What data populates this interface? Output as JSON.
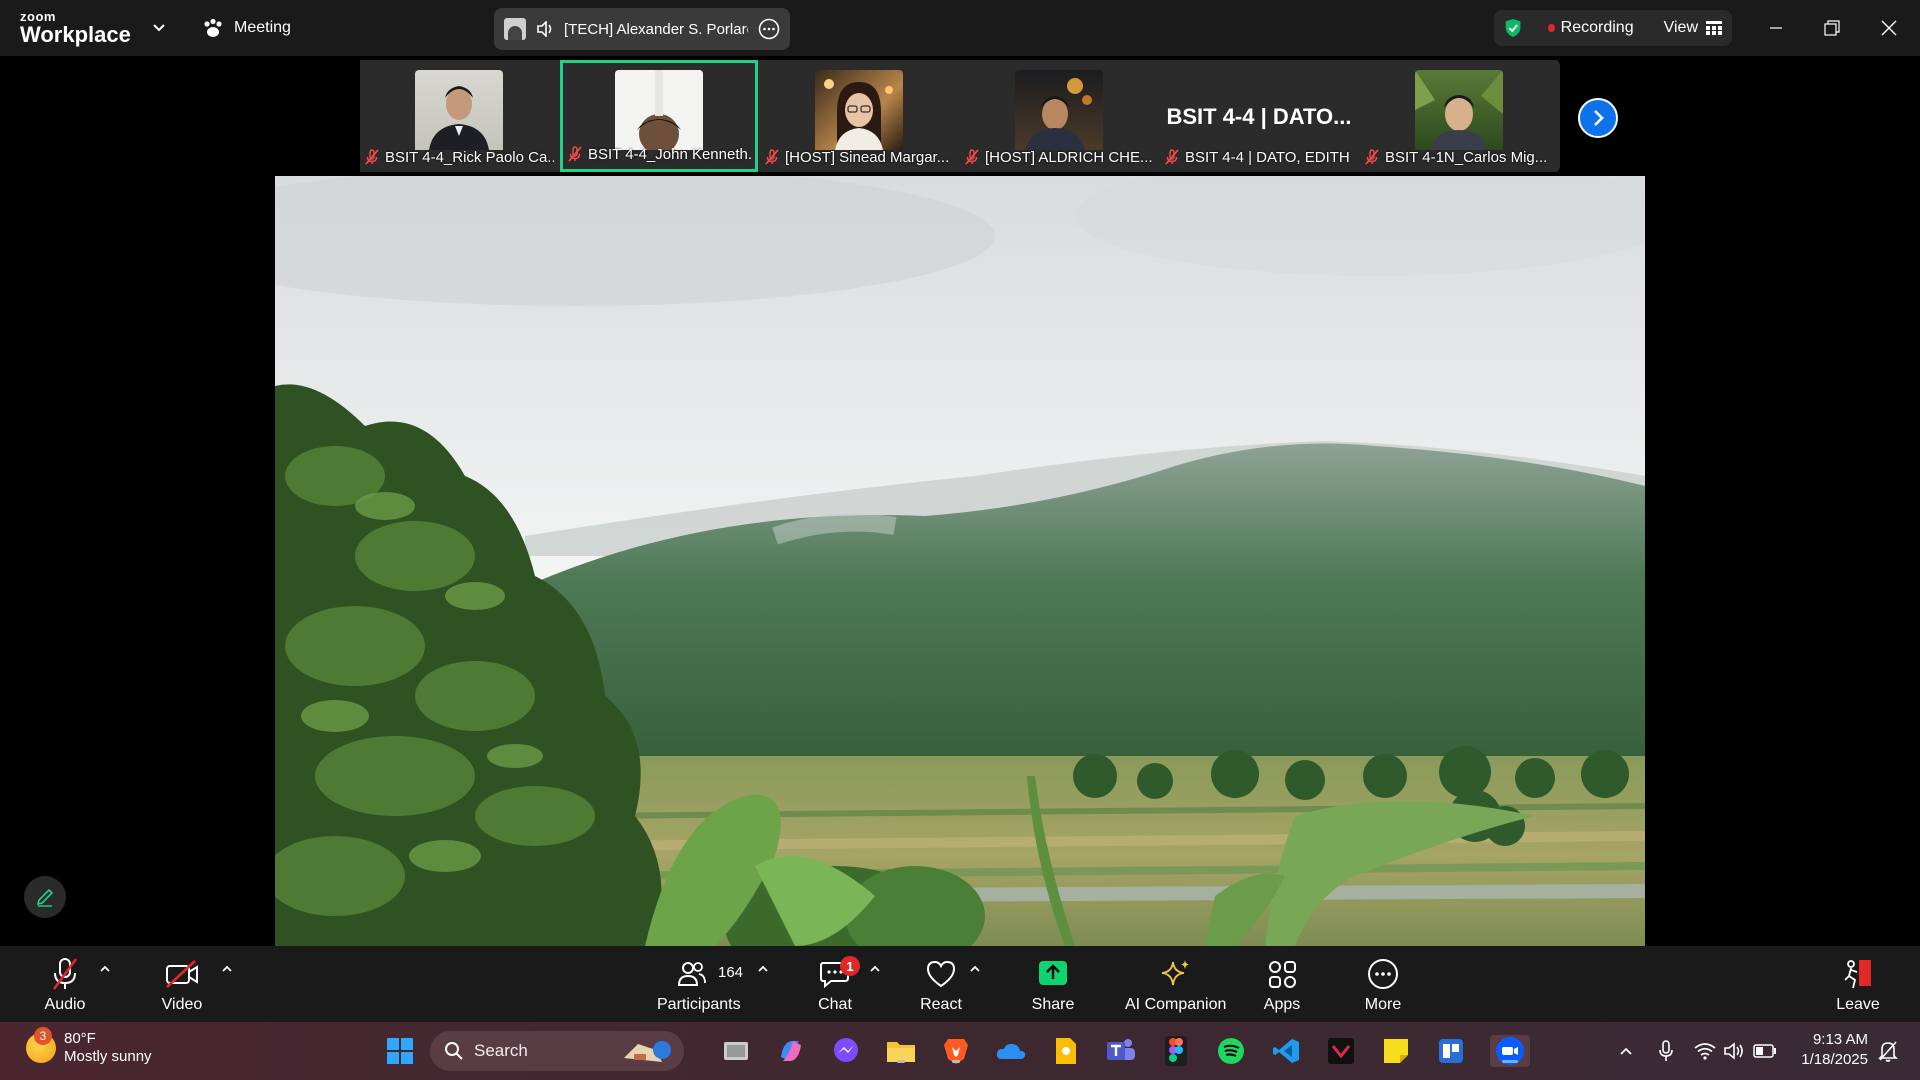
{
  "app": {
    "brand_small": "zoom",
    "brand_big": "Workplace",
    "meeting_label": "Meeting",
    "active_speaker": "[TECH] Alexander S. Porlares",
    "recording_label": "Recording",
    "view_label": "View"
  },
  "gallery": {
    "tiles": [
      {
        "name": "BSIT 4-4_Rick Paolo Ca...",
        "kind": "video"
      },
      {
        "name": "BSIT 4-4_John Kenneth...",
        "kind": "video",
        "active": true
      },
      {
        "name": "[HOST] Sinead Margar...",
        "kind": "video"
      },
      {
        "name": "[HOST] ALDRICH CHE...",
        "kind": "video"
      },
      {
        "name": "BSIT 4-4 | DATO, EDITH",
        "kind": "name",
        "display_name": "BSIT 4-4 | DATO..."
      },
      {
        "name": "BSIT 4-1N_Carlos Mig...",
        "kind": "video"
      }
    ]
  },
  "controls": {
    "audio": "Audio",
    "video": "Video",
    "participants": "Participants",
    "participants_count": "164",
    "chat": "Chat",
    "chat_badge": "1",
    "react": "React",
    "share": "Share",
    "ai_companion": "AI Companion",
    "apps": "Apps",
    "more": "More",
    "leave": "Leave"
  },
  "taskbar": {
    "weather_temp": "80°F",
    "weather_desc": "Mostly sunny",
    "weather_badge": "3",
    "search_label": "Search",
    "time": "9:13 AM",
    "date": "1/18/2025"
  },
  "colors": {
    "active_border": "#23d18b",
    "share_green": "#0fd270",
    "recording_red": "#e02828",
    "zoom_blue": "#0e72ed"
  }
}
